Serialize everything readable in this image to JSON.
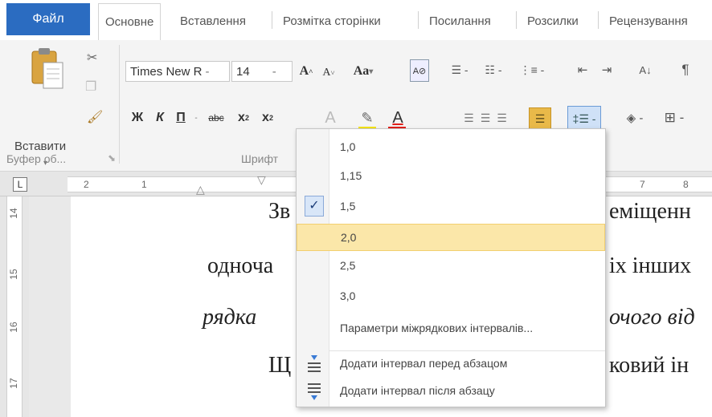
{
  "tabs": {
    "file": "Файл",
    "items": [
      "Основне",
      "Вставлення",
      "Розмітка сторінки",
      "Посилання",
      "Розсилки",
      "Рецензування"
    ]
  },
  "clipboard": {
    "paste_label": "Вставити",
    "group_label": "Буфер об..."
  },
  "font": {
    "name": "Times New R",
    "size": "14",
    "group_label": "Шрифт",
    "grow": "A",
    "shrink": "A",
    "case": "Aa",
    "bold": "Ж",
    "italic": "К",
    "underline": "П",
    "strike": "abc",
    "sub": "x",
    "sup": "x"
  },
  "ruler": {
    "corner": "L",
    "numbers": [
      "2",
      "1",
      "7",
      "8"
    ]
  },
  "vruler": {
    "numbers": [
      "14",
      "15",
      "16",
      "17"
    ]
  },
  "document": {
    "lines": [
      "Зв",
      "еміщенн",
      "одноча",
      "іх іншиx",
      "рядка",
      "очого від",
      "Щ",
      "ковий ін"
    ]
  },
  "line_spacing_menu": {
    "items": [
      {
        "label": "1,0",
        "checked": false,
        "highlighted": false
      },
      {
        "label": "1,15",
        "checked": false,
        "highlighted": false
      },
      {
        "label": "1,5",
        "checked": true,
        "highlighted": false
      },
      {
        "label": "2,0",
        "checked": false,
        "highlighted": true
      },
      {
        "label": "2,5",
        "checked": false,
        "highlighted": false
      },
      {
        "label": "3,0",
        "checked": false,
        "highlighted": false
      }
    ],
    "options_label": "Параметри міжрядкових інтервалів...",
    "add_before": "Додати інтервал перед абзацом",
    "add_after": "Додати інтервал після абзацу",
    "check_mark": "✓"
  },
  "colors": {
    "file_tab": "#2b6cc1",
    "highlight": "#fbe7a9",
    "highlight_border": "#f2cf6f",
    "font_color_bar": "#e0201a",
    "highlighter_bar": "#f5e400"
  }
}
